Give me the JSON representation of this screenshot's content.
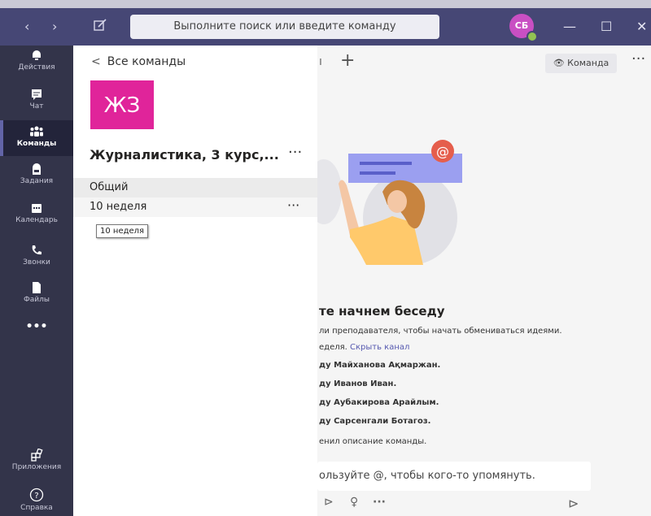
{
  "titlebar": {
    "search_placeholder": "Выполните поиск или введите команду",
    "avatar_initials": "СБ",
    "colors": {
      "titlebar": "#464775",
      "rail": "#33344a",
      "accent": "#6264a7"
    }
  },
  "rail": {
    "items": [
      {
        "label": "Действия",
        "icon": "bell-icon"
      },
      {
        "label": "Чат",
        "icon": "chat-icon"
      },
      {
        "label": "Команды",
        "icon": "teams-icon"
      },
      {
        "label": "Задания",
        "icon": "assignments-icon"
      },
      {
        "label": "Календарь",
        "icon": "calendar-icon"
      },
      {
        "label": "Звонки",
        "icon": "phone-icon"
      },
      {
        "label": "Файлы",
        "icon": "files-icon"
      },
      {
        "label": "Приложения",
        "icon": "apps-icon"
      },
      {
        "label": "Справка",
        "icon": "help-icon"
      }
    ],
    "more": "•••"
  },
  "panel": {
    "back_label": "Все команды",
    "team_initials": "ЖЗ",
    "team_color": "#e0249a",
    "team_name": "Журналистика, 3 курс,...",
    "more": "···",
    "channels": [
      {
        "label": "Общий"
      },
      {
        "label": "10 неделя",
        "more": "···"
      }
    ],
    "tooltip": "10 неделя"
  },
  "main": {
    "partial_tab": "ı",
    "team_button": "Команда",
    "heading": "те начнем беседу",
    "lines": [
      "ли преподавателя, чтобы начать обмениваться идеями.",
      "еделя.",
      "ду Майханова Ақмаржан.",
      "ду Иванов Иван.",
      "ду Аубакирова Арайлым.",
      "ду Сарсенгали Ботагоз.",
      "енил описание команды."
    ],
    "hide_channel_link": "Скрыть канал",
    "compose_placeholder": "ользуйте @, чтобы кого-то упомянуть.",
    "more": "···"
  }
}
